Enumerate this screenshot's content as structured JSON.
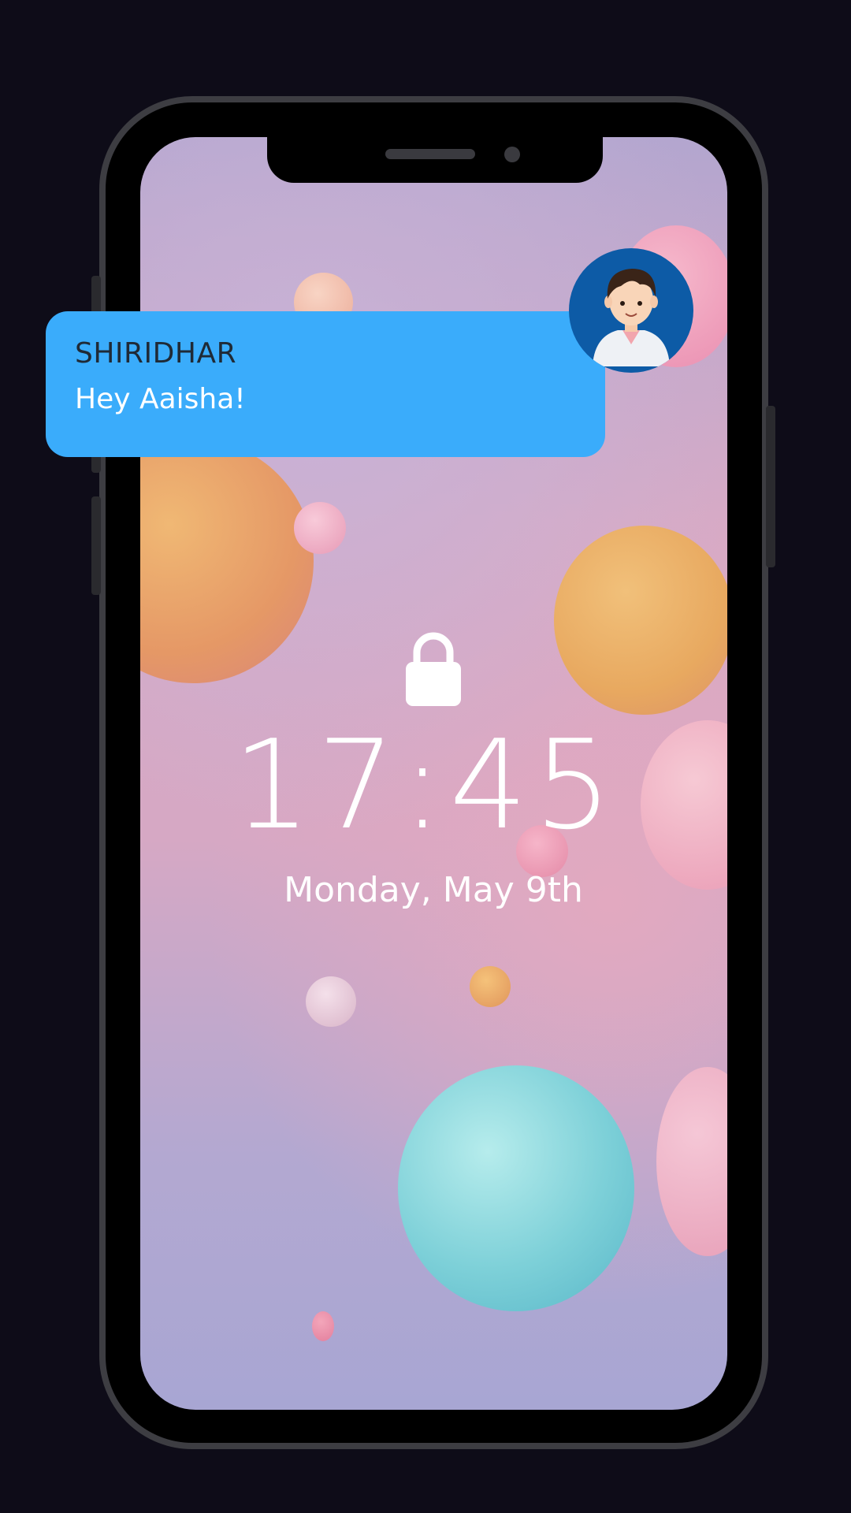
{
  "lockscreen": {
    "time": "17:45",
    "date": "Monday, May 9th"
  },
  "notification": {
    "sender": "SHIRIDHAR",
    "message": "Hey Aaisha!",
    "color": "#3aacfb"
  },
  "icons": {
    "lock": "lock-icon",
    "avatar": "avatar"
  }
}
